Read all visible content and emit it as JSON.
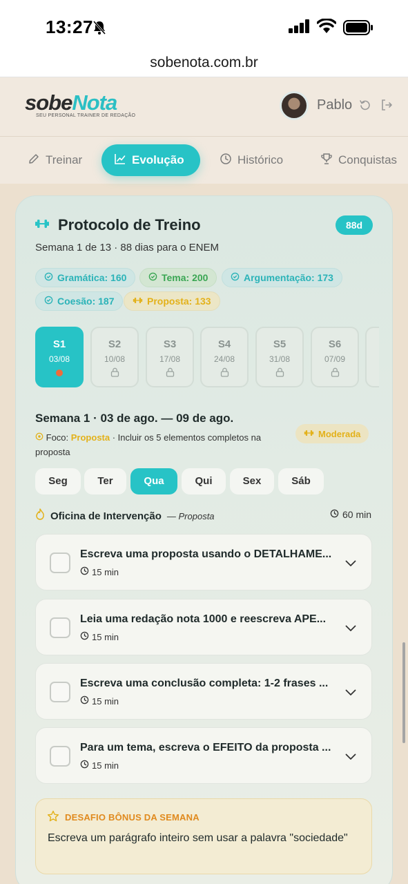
{
  "status_bar": {
    "time": "13:27"
  },
  "browser": {
    "url": "sobenota.com.br"
  },
  "header": {
    "logo_part1": "sobe",
    "logo_part2": "Nota",
    "tagline": "SEU PERSONAL TRAINER DE REDAÇÃO",
    "username": "Pablo"
  },
  "tabs": [
    {
      "label": "Treinar",
      "icon": "pencil-icon"
    },
    {
      "label": "Evolução",
      "icon": "chart-icon",
      "active": true
    },
    {
      "label": "Histórico",
      "icon": "clock-icon"
    },
    {
      "label": "Conquistas",
      "icon": "trophy-icon"
    }
  ],
  "protocol": {
    "title": "Protocolo de Treino",
    "days_badge": "88d",
    "subtitle": "Semana 1 de 13 · 88 dias para o ENEM",
    "skills": [
      {
        "label": "Gramática: 160"
      },
      {
        "label": "Tema: 200"
      },
      {
        "label": "Argumentação: 173"
      },
      {
        "label": "Coesão: 187"
      },
      {
        "label": "Proposta: 133"
      }
    ],
    "weeks": [
      {
        "label": "S1",
        "date": "03/08",
        "active": true
      },
      {
        "label": "S2",
        "date": "10/08",
        "locked": true
      },
      {
        "label": "S3",
        "date": "17/08",
        "locked": true
      },
      {
        "label": "S4",
        "date": "24/08",
        "locked": true
      },
      {
        "label": "S5",
        "date": "31/08",
        "locked": true
      },
      {
        "label": "S6",
        "date": "07/09",
        "locked": true
      }
    ],
    "week_title": "Semana 1 · 03 de ago. — 09 de ago.",
    "focus_label": "Foco:",
    "focus_word": "Proposta",
    "focus_text": " · Incluir os 5 elementos completos na proposta",
    "intensity": "Moderada",
    "days": [
      {
        "label": "Seg"
      },
      {
        "label": "Ter"
      },
      {
        "label": "Qua",
        "active": true
      },
      {
        "label": "Qui"
      },
      {
        "label": "Sex"
      },
      {
        "label": "Sáb"
      }
    ],
    "workshop_title": "Oficina de Intervenção",
    "workshop_competence": "— Proposta",
    "workshop_duration": "60 min",
    "tasks": [
      {
        "title": "Escreva uma proposta usando o DETALHAME...",
        "time": "15 min"
      },
      {
        "title": "Leia uma redação nota 1000 e reescreva APE...",
        "time": "15 min"
      },
      {
        "title": "Escreva uma conclusão completa: 1-2 frases ...",
        "time": "15 min"
      },
      {
        "title": "Para um tema, escreva o EFEITO da proposta ...",
        "time": "15 min"
      }
    ],
    "bonus_heading": "DESAFIO BÔNUS DA SEMANA",
    "bonus_text": "Escreva um parágrafo inteiro sem usar a palavra \"sociedade\""
  },
  "colors": {
    "accent": "#27c3c6",
    "warning": "#e3b11a",
    "success": "#3aa653",
    "bonus": "#e08a1e"
  }
}
